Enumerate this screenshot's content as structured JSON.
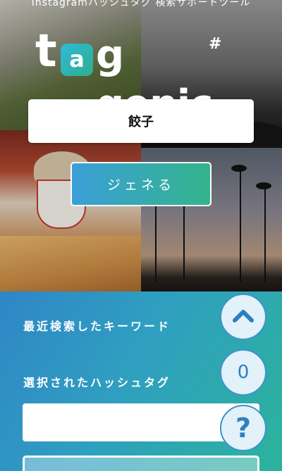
{
  "header": {
    "tagline": "Instagramハッシュタグ 検索サポートツール",
    "logo_letter_t": "t",
    "logo_badge": "a",
    "logo_rest": "g genic",
    "logo_hash": "#"
  },
  "search": {
    "value": "餃子"
  },
  "generate": {
    "label": "ジェネる"
  },
  "sections": {
    "recent_label": "最近検索したキーワード",
    "selected_label": "選択されたハッシュタグ"
  },
  "floating": {
    "scroll_top_icon": "chevron-up-icon",
    "selected_count": "0",
    "help_label": "?"
  },
  "colors": {
    "accent_blue": "#2f86c6",
    "accent_green": "#2cb39b"
  }
}
